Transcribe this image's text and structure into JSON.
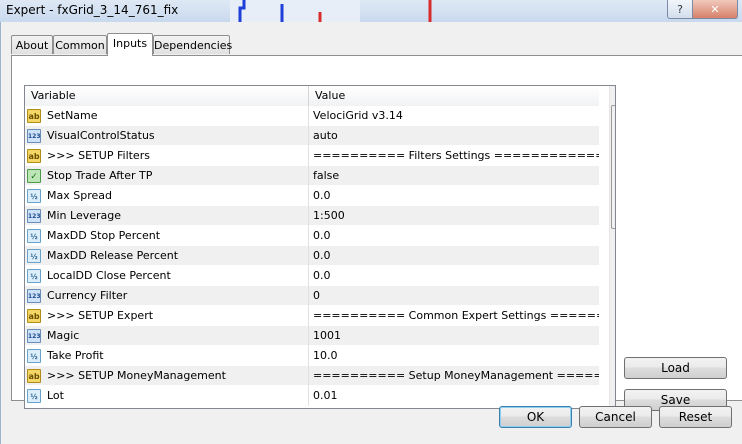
{
  "window": {
    "title": "Expert - fxGrid_3_14_761_fix",
    "help_label": "?",
    "close_label": "✕"
  },
  "tabs": [
    "About",
    "Common",
    "Inputs",
    "Dependencies"
  ],
  "active_tab": "Inputs",
  "grid": {
    "columns": [
      "Variable",
      "Value"
    ],
    "rows": [
      {
        "icon": "string-icon",
        "name": "SetName",
        "value": "VelociGrid v3.14"
      },
      {
        "icon": "integer-icon",
        "name": "VisualControlStatus",
        "value": "auto"
      },
      {
        "icon": "string-icon",
        "name": ">>> SETUP Filters",
        "value": "========== Filters Settings =================="
      },
      {
        "icon": "boolean-icon",
        "name": "Stop Trade After TP",
        "value": "false"
      },
      {
        "icon": "double-icon",
        "name": "Max Spread",
        "value": "0.0"
      },
      {
        "icon": "integer-icon",
        "name": "Min Leverage",
        "value": "1:500"
      },
      {
        "icon": "double-icon",
        "name": "MaxDD Stop Percent",
        "value": "0.0"
      },
      {
        "icon": "double-icon",
        "name": "MaxDD Release Percent",
        "value": "0.0"
      },
      {
        "icon": "double-icon",
        "name": "LocalDD Close Percent",
        "value": "0.0"
      },
      {
        "icon": "integer-icon",
        "name": "Currency Filter",
        "value": "0"
      },
      {
        "icon": "string-icon",
        "name": ">>> SETUP Expert",
        "value": "========== Common Expert Settings ============"
      },
      {
        "icon": "integer-icon",
        "name": "Magic",
        "value": "1001"
      },
      {
        "icon": "double-icon",
        "name": "Take Profit",
        "value": "10.0"
      },
      {
        "icon": "string-icon",
        "name": ">>> SETUP MoneyManagement",
        "value": "========== Setup MoneyManagement ============="
      },
      {
        "icon": "double-icon",
        "name": "Lot",
        "value": "0.01"
      }
    ]
  },
  "icon_glyphs": {
    "string-icon": "ab",
    "integer-icon": "123",
    "double-icon": "½",
    "boolean-icon": "✓"
  },
  "buttons": {
    "load": "Load",
    "save": "Save",
    "ok": "OK",
    "cancel": "Cancel",
    "reset": "Reset"
  },
  "scrollbar": {
    "up": "▲",
    "down": "▼"
  },
  "colors": {
    "title_bar": "#c9d9ee",
    "close_button": "#d7816a",
    "row_alt": "#f0f0f0"
  }
}
